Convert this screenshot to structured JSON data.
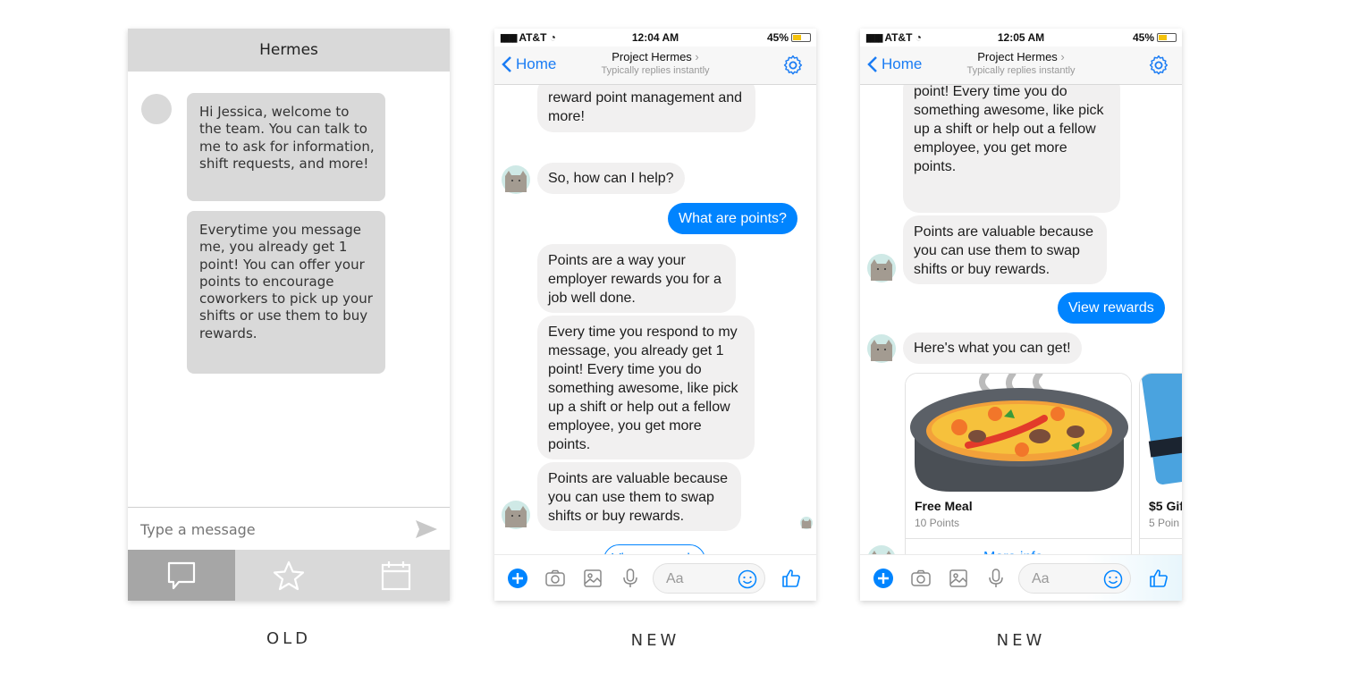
{
  "captions": {
    "old": "OLD",
    "new1": "NEW",
    "new2": "NEW"
  },
  "old_app": {
    "title": "Hermes",
    "messages": [
      "Hi Jessica, welcome to the team. You can talk to me to ask for information, shift requests, and more!",
      "Everytime you message me, you already get 1 point! You can offer your points to encourage coworkers to pick up your shifts or use them to buy rewards."
    ],
    "input_placeholder": "Type a message",
    "tabs": [
      "chat-icon",
      "star-icon",
      "calendar-icon"
    ]
  },
  "messenger1": {
    "carrier": "AT&T",
    "time": "12:04 AM",
    "battery": "45%",
    "back_label": "Home",
    "title": "Project Hermes",
    "subtitle": "Typically replies instantly",
    "messages": {
      "m0": "reward point management and more!",
      "m1": "So, how can I help?",
      "me1": "What are points?",
      "m2": "Points are a way your employer rewards you for a job well done.",
      "m3": "Every time you respond to my message, you already get 1 point! Every time you do something awesome, like pick up a shift or help out a fellow employee, you get more points.",
      "m4": "Points are valuable because you can use them to swap shifts or buy rewards."
    },
    "quick_reply": "View rewards",
    "composer_placeholder": "Aa"
  },
  "messenger2": {
    "carrier": "AT&T",
    "time": "12:05 AM",
    "battery": "45%",
    "back_label": "Home",
    "title": "Project Hermes",
    "subtitle": "Typically replies instantly",
    "messages": {
      "m0": "point! Every time you do something awesome, like pick up a shift or help out a fellow employee, you get more points.",
      "m1": "Points are valuable because you can use them to swap shifts or buy rewards.",
      "me1": "View rewards",
      "m2": "Here's what you can get!"
    },
    "cards": [
      {
        "title": "Free Meal",
        "subtitle": "10 Points",
        "button": "More info..."
      },
      {
        "title": "$5 Gif",
        "subtitle": "5 Poin"
      }
    ],
    "composer_placeholder": "Aa"
  },
  "colors": {
    "messenger_blue": "#0084ff",
    "old_gray": "#d9d9d9",
    "old_tab_active": "#a6a6a6"
  }
}
